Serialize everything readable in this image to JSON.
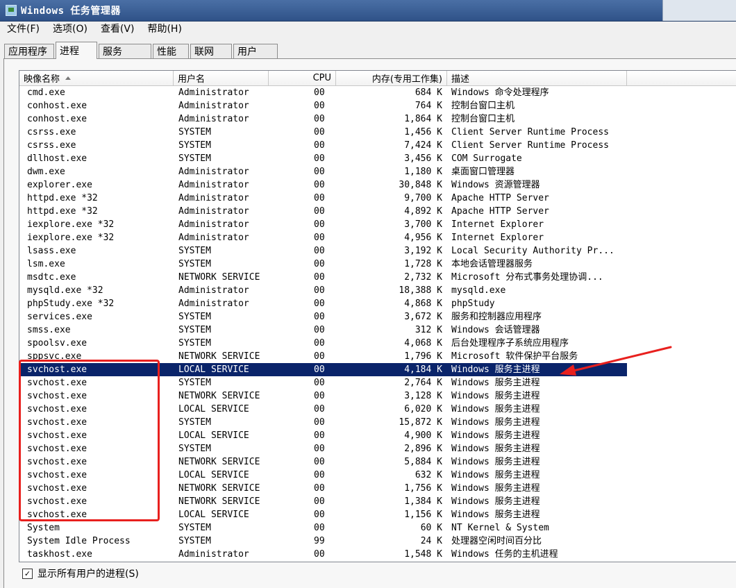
{
  "window": {
    "title": "Windows 任务管理器"
  },
  "menu": [
    "文件(F)",
    "选项(O)",
    "查看(V)",
    "帮助(H)"
  ],
  "tabs": [
    "应用程序",
    "进程",
    "服务",
    "性能",
    "联网",
    "用户"
  ],
  "active_tab": "进程",
  "columns": {
    "name": "映像名称",
    "user": "用户名",
    "cpu": "CPU",
    "mem": "内存(专用工作集)",
    "desc": "描述"
  },
  "processes": [
    {
      "name": "cmd.exe",
      "user": "Administrator",
      "cpu": "00",
      "mem": "684 K",
      "desc": "Windows 命令处理程序"
    },
    {
      "name": "conhost.exe",
      "user": "Administrator",
      "cpu": "00",
      "mem": "764 K",
      "desc": "控制台窗口主机"
    },
    {
      "name": "conhost.exe",
      "user": "Administrator",
      "cpu": "00",
      "mem": "1,864 K",
      "desc": "控制台窗口主机"
    },
    {
      "name": "csrss.exe",
      "user": "SYSTEM",
      "cpu": "00",
      "mem": "1,456 K",
      "desc": "Client Server Runtime Process"
    },
    {
      "name": "csrss.exe",
      "user": "SYSTEM",
      "cpu": "00",
      "mem": "7,424 K",
      "desc": "Client Server Runtime Process"
    },
    {
      "name": "dllhost.exe",
      "user": "SYSTEM",
      "cpu": "00",
      "mem": "3,456 K",
      "desc": "COM Surrogate"
    },
    {
      "name": "dwm.exe",
      "user": "Administrator",
      "cpu": "00",
      "mem": "1,180 K",
      "desc": "桌面窗口管理器"
    },
    {
      "name": "explorer.exe",
      "user": "Administrator",
      "cpu": "00",
      "mem": "30,848 K",
      "desc": "Windows 资源管理器"
    },
    {
      "name": "httpd.exe *32",
      "user": "Administrator",
      "cpu": "00",
      "mem": "9,700 K",
      "desc": "Apache HTTP Server"
    },
    {
      "name": "httpd.exe *32",
      "user": "Administrator",
      "cpu": "00",
      "mem": "4,892 K",
      "desc": "Apache HTTP Server"
    },
    {
      "name": "iexplore.exe *32",
      "user": "Administrator",
      "cpu": "00",
      "mem": "3,700 K",
      "desc": "Internet Explorer"
    },
    {
      "name": "iexplore.exe *32",
      "user": "Administrator",
      "cpu": "00",
      "mem": "4,956 K",
      "desc": "Internet Explorer"
    },
    {
      "name": "lsass.exe",
      "user": "SYSTEM",
      "cpu": "00",
      "mem": "3,192 K",
      "desc": "Local Security Authority Pr..."
    },
    {
      "name": "lsm.exe",
      "user": "SYSTEM",
      "cpu": "00",
      "mem": "1,728 K",
      "desc": "本地会话管理器服务"
    },
    {
      "name": "msdtc.exe",
      "user": "NETWORK SERVICE",
      "cpu": "00",
      "mem": "2,732 K",
      "desc": "Microsoft 分布式事务处理协调..."
    },
    {
      "name": "mysqld.exe *32",
      "user": "Administrator",
      "cpu": "00",
      "mem": "18,388 K",
      "desc": "mysqld.exe"
    },
    {
      "name": "phpStudy.exe *32",
      "user": "Administrator",
      "cpu": "00",
      "mem": "4,868 K",
      "desc": "phpStudy"
    },
    {
      "name": "services.exe",
      "user": "SYSTEM",
      "cpu": "00",
      "mem": "3,672 K",
      "desc": "服务和控制器应用程序"
    },
    {
      "name": "smss.exe",
      "user": "SYSTEM",
      "cpu": "00",
      "mem": "312 K",
      "desc": "Windows 会话管理器"
    },
    {
      "name": "spoolsv.exe",
      "user": "SYSTEM",
      "cpu": "00",
      "mem": "4,068 K",
      "desc": "后台处理程序子系统应用程序"
    },
    {
      "name": "sppsvc.exe",
      "user": "NETWORK SERVICE",
      "cpu": "00",
      "mem": "1,796 K",
      "desc": "Microsoft 软件保护平台服务"
    },
    {
      "name": "svchost.exe",
      "user": "LOCAL SERVICE",
      "cpu": "00",
      "mem": "4,184 K",
      "desc": "Windows 服务主进程",
      "selected": true
    },
    {
      "name": "svchost.exe",
      "user": "SYSTEM",
      "cpu": "00",
      "mem": "2,764 K",
      "desc": "Windows 服务主进程"
    },
    {
      "name": "svchost.exe",
      "user": "NETWORK SERVICE",
      "cpu": "00",
      "mem": "3,128 K",
      "desc": "Windows 服务主进程"
    },
    {
      "name": "svchost.exe",
      "user": "LOCAL SERVICE",
      "cpu": "00",
      "mem": "6,020 K",
      "desc": "Windows 服务主进程"
    },
    {
      "name": "svchost.exe",
      "user": "SYSTEM",
      "cpu": "00",
      "mem": "15,872 K",
      "desc": "Windows 服务主进程"
    },
    {
      "name": "svchost.exe",
      "user": "LOCAL SERVICE",
      "cpu": "00",
      "mem": "4,900 K",
      "desc": "Windows 服务主进程"
    },
    {
      "name": "svchost.exe",
      "user": "SYSTEM",
      "cpu": "00",
      "mem": "2,896 K",
      "desc": "Windows 服务主进程"
    },
    {
      "name": "svchost.exe",
      "user": "NETWORK SERVICE",
      "cpu": "00",
      "mem": "5,884 K",
      "desc": "Windows 服务主进程"
    },
    {
      "name": "svchost.exe",
      "user": "LOCAL SERVICE",
      "cpu": "00",
      "mem": "632 K",
      "desc": "Windows 服务主进程"
    },
    {
      "name": "svchost.exe",
      "user": "NETWORK SERVICE",
      "cpu": "00",
      "mem": "1,756 K",
      "desc": "Windows 服务主进程"
    },
    {
      "name": "svchost.exe",
      "user": "NETWORK SERVICE",
      "cpu": "00",
      "mem": "1,384 K",
      "desc": "Windows 服务主进程"
    },
    {
      "name": "svchost.exe",
      "user": "LOCAL SERVICE",
      "cpu": "00",
      "mem": "1,156 K",
      "desc": "Windows 服务主进程"
    },
    {
      "name": "System",
      "user": "SYSTEM",
      "cpu": "00",
      "mem": "60 K",
      "desc": "NT Kernel & System"
    },
    {
      "name": "System Idle Process",
      "user": "SYSTEM",
      "cpu": "99",
      "mem": "24 K",
      "desc": "处理器空闲时间百分比"
    },
    {
      "name": "taskhost.exe",
      "user": "Administrator",
      "cpu": "00",
      "mem": "1,548 K",
      "desc": "Windows 任务的主机进程"
    }
  ],
  "show_all_users": {
    "label": "显示所有用户的进程(S)",
    "checked": true,
    "mark": "✓"
  },
  "colors": {
    "selection": "#0a246a",
    "annotation": "#e8201e",
    "titlebar": "#2f5288"
  },
  "icons": {
    "app": "task-manager-icon",
    "sort": "sort-ascending-icon",
    "checkbox": "checkmark-icon"
  }
}
